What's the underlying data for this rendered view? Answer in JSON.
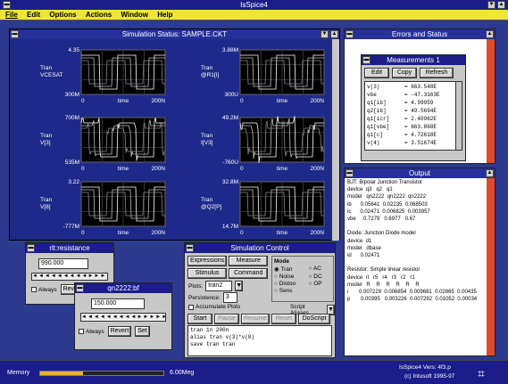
{
  "app": {
    "title": "IsSpice4"
  },
  "menu": [
    "File",
    "Edit",
    "Options",
    "Actions",
    "Window",
    "Help"
  ],
  "simstatus": {
    "title": "Simulation Status: SAMPLE.CKT",
    "plots": [
      {
        "name": "VCESAT",
        "kind": "Tran",
        "top": "4.35",
        "bottom": "300M",
        "x0": "0",
        "xmid": "time",
        "xend": "200N"
      },
      {
        "name": "@R1[I]",
        "kind": "Tran",
        "top": "3.88M",
        "bottom": "300U",
        "x0": "0",
        "xmid": "time",
        "xend": "200N"
      },
      {
        "name": "V[3]",
        "kind": "Tran",
        "top": "700M",
        "bottom": "535M",
        "x0": "0",
        "xmid": "time",
        "xend": "200N"
      },
      {
        "name": "I[V3]",
        "kind": "Tran",
        "top": "49.2M",
        "bottom": "-760U",
        "x0": "0",
        "xmid": "time",
        "xend": "200N"
      },
      {
        "name": "V[8]",
        "kind": "Tran",
        "top": "3.22",
        "bottom": "-777M",
        "x0": "0",
        "xmid": "time",
        "xend": "200N"
      },
      {
        "name": "@Q2[P]",
        "kind": "Tran",
        "top": "32.8M",
        "bottom": "14.7M",
        "x0": "0",
        "xmid": "time",
        "xend": "200N"
      }
    ]
  },
  "errors": {
    "title": "Errors and Status"
  },
  "measurements": {
    "title": "Measurements 1",
    "edit": "Edit",
    "copy": "Copy",
    "refresh": "Refresh",
    "rows": [
      [
        "v(3)",
        "= 663.548E"
      ],
      [
        "vbe",
        "= -47.3163E"
      ],
      [
        "q1[ib]",
        "= 4.99959"
      ],
      [
        "q2[ib]",
        "= 49.5694E"
      ],
      [
        "q1[icr]",
        "= 2.40962E"
      ],
      [
        "q1[vbe]",
        "= 663.868E"
      ],
      [
        "q1[c]",
        "= 4.72618E"
      ],
      [
        "v(4)",
        "= 3.51674E"
      ]
    ]
  },
  "output": {
    "title": "Output",
    "lines": [
      "BJT: Bipolar Junction Transistor",
      "device  q3   q2   q1",
      "model   qn2222  qn2222  qn2222",
      "ib      0.05641  0.02235  0.068503",
      "ic      0.02471  0.006825  0.003957",
      "vbe     0.7279   0.6977   0.67",
      "",
      "Diode: Junction Diode model",
      "device  d1",
      "model   dbase",
      "id      0.02471",
      "",
      "Resistor: Simple linear resistor",
      "device  rl   r5   r4   r3   r2   r1",
      "model   R    R    R    R    R    R",
      "i       0.007229  0.006854  0.009681  0.02865  0.00435",
      "p       0.00395   0.003226  0.007292  0.01052  0.00034"
    ]
  },
  "rlt": {
    "title": "rlt:resistance",
    "value": "990.000",
    "always": "Always",
    "revert": "Revert"
  },
  "q2": {
    "title": "qn2222:bf",
    "value": "150.000",
    "always": "Always",
    "revert": "Revert",
    "set": "Set"
  },
  "simcontrol": {
    "title": "Simulation Control",
    "buttons": [
      "Expressions",
      "Measure",
      "Stimulus",
      "Command"
    ],
    "plots_label": "Plots:",
    "plots_value": "tran2",
    "persistence_label": "Persistence:",
    "persistence_value": "3",
    "accumulate": "Accumulate Plots",
    "mode_label": "Mode",
    "modes": [
      "Tran",
      "AC",
      "Noise",
      "DC",
      "Distoo",
      "OP",
      "Sens"
    ],
    "script": "Script Aliases",
    "actions": [
      "Start",
      "Pause",
      "Resume",
      "Reset",
      "DoScript"
    ],
    "log": [
      "tran 1n 200n",
      "alias tran v(3)*v(8)",
      "save tran tran"
    ]
  },
  "status": {
    "memory_label": "Memory",
    "memory_value": "6.00Meg",
    "version": "IsSpice4 Vers: 4f3.p",
    "copyright": "(c) Intusoft 1995-97"
  },
  "colors": {
    "desktop": "#2c3a8f",
    "titlebar": "#1a1d8a",
    "accent": "#e04a2a",
    "menubar": "#f0e43a"
  }
}
